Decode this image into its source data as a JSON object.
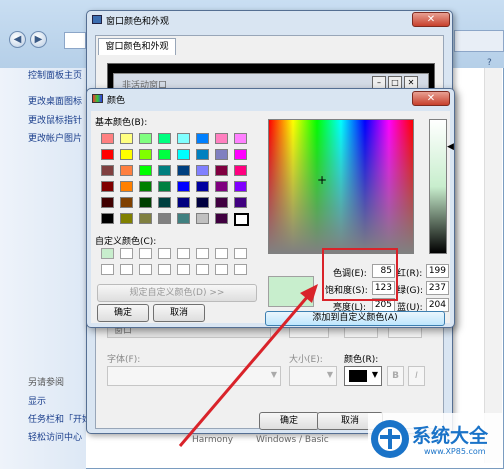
{
  "colors": {
    "accent": "#d9232a",
    "logo_blue": "#1a73c8",
    "selected_color": "#c8eecd"
  },
  "control_panel": {
    "left_links": [
      "控制面板主页",
      "更改桌面图标",
      "更改鼠标指针",
      "更改帐户图片"
    ],
    "see_also": {
      "heading": "另请参阅",
      "items": [
        "显示",
        "任务栏和「开始」",
        "轻松访问中心"
      ]
    }
  },
  "appearance_dialog": {
    "title": "窗口颜色和外观",
    "tab": "窗口颜色和外观",
    "inactive_window": "非活动窗口",
    "item_label": "窗口",
    "font_label": "字体(F):",
    "size_label": "大小(E):",
    "color_label": "颜色(R):",
    "bold_label": "B",
    "italic_label": "I",
    "ok": "确定",
    "cancel": "取消",
    "theme_names": [
      "Harmony",
      "Windows / Basic"
    ]
  },
  "color_dialog": {
    "title": "颜色",
    "basic_label": "基本颜色(B):",
    "custom_label": "自定义颜色(C):",
    "define_button": "规定自定义颜色(D) >>",
    "ok": "确定",
    "cancel": "取消",
    "add_button": "添加到自定义颜色(A)",
    "solid_label": "颜色",
    "fields": {
      "hue": {
        "label": "色调(E):",
        "value": "85"
      },
      "sat": {
        "label": "饱和度(S):",
        "value": "123"
      },
      "lum": {
        "label": "亮度(L):",
        "value": "205"
      },
      "red": {
        "label": "红(R):",
        "value": "199"
      },
      "green": {
        "label": "绿(G):",
        "value": "237"
      },
      "blue": {
        "label": "蓝(U):",
        "value": "204"
      }
    },
    "basic_colors": [
      [
        "#ff8080",
        "#ffff80",
        "#80ff80",
        "#00ff80",
        "#80ffff",
        "#0080ff",
        "#ff80c0",
        "#ff80ff"
      ],
      [
        "#ff0000",
        "#ffff00",
        "#80ff00",
        "#00ff40",
        "#00ffff",
        "#0080c0",
        "#8080c0",
        "#ff00ff"
      ],
      [
        "#804040",
        "#ff8040",
        "#00ff00",
        "#008080",
        "#004080",
        "#8080ff",
        "#800040",
        "#ff0080"
      ],
      [
        "#800000",
        "#ff8000",
        "#008000",
        "#008040",
        "#0000ff",
        "#0000a0",
        "#800080",
        "#8000ff"
      ],
      [
        "#400000",
        "#804000",
        "#004000",
        "#004040",
        "#000080",
        "#000040",
        "#400040",
        "#400080"
      ],
      [
        "#000000",
        "#808000",
        "#808040",
        "#808080",
        "#408080",
        "#c0c0c0",
        "#400040",
        "#ffffff"
      ]
    ]
  },
  "watermark": {
    "brand": "系统大全",
    "url": "www.XP85.com"
  }
}
